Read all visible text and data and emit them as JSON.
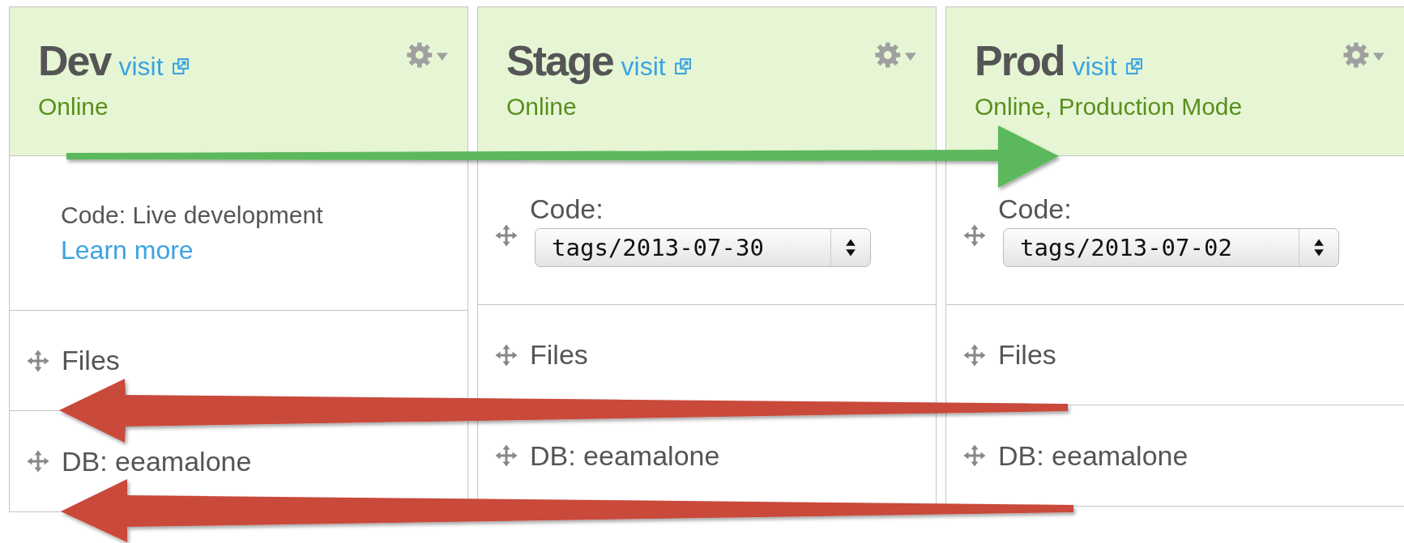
{
  "environments": [
    {
      "name": "Dev",
      "link": "visit",
      "status": "Online",
      "code": {
        "kind": "text",
        "text": "Code: Live development",
        "link": "Learn more"
      },
      "items": [
        "Files",
        "DB: eeamalone"
      ]
    },
    {
      "name": "Stage",
      "link": "visit",
      "status": "Online",
      "code": {
        "kind": "select",
        "label": "Code:",
        "value": "tags/2013-07-30"
      },
      "items": [
        "Files",
        "DB: eeamalone"
      ]
    },
    {
      "name": "Prod",
      "link": "visit",
      "status": "Online, Production Mode",
      "code": {
        "kind": "select",
        "label": "Code:",
        "value": "tags/2013-07-02"
      },
      "items": [
        "Files",
        "DB: eeamalone"
      ]
    }
  ]
}
